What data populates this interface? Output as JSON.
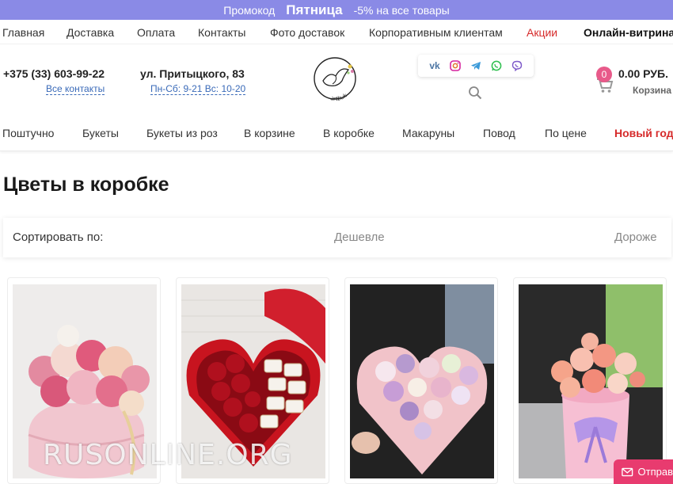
{
  "promo": {
    "prefix": "Промокод",
    "code": "Пятница",
    "discount": "-5% на все товары"
  },
  "topnav": {
    "items": [
      "Главная",
      "Доставка",
      "Оплата",
      "Контакты",
      "Фото доставок",
      "Корпоративным клиентам",
      "Акции",
      "Онлайн-витрина"
    ]
  },
  "header": {
    "phone": "+375 (33) 603-99-22",
    "all_contacts": "Все контакты",
    "address": "ул. Притыцкого, 83",
    "hours": "Пн-Сб: 9-21   Вс: 10-20",
    "logo_text": "artbuket",
    "social_icons": [
      "vk-icon",
      "instagram-icon",
      "telegram-icon",
      "whatsapp-icon",
      "viber-icon"
    ],
    "cart_count": "0",
    "cart_price": "0.00 РУБ.",
    "cart_label": "Корзина"
  },
  "catnav": {
    "items": [
      "Поштучно",
      "Букеты",
      "Букеты из роз",
      "В корзине",
      "В коробке",
      "Макаруны",
      "Повод",
      "По цене",
      "Новый год"
    ]
  },
  "page": {
    "title": "Цветы в коробке"
  },
  "sort": {
    "label": "Сортировать по:",
    "cheaper": "Дешевле",
    "expensive": "Дороже"
  },
  "watermark": "RUSONLINE.ORG",
  "send_button": "Отправ",
  "colors": {
    "promo_bg": "#8a8ae6",
    "accent_red": "#d62b2b",
    "link_blue": "#3a6ab8",
    "badge_pink": "#e85a8a",
    "send_bg": "#e83b6f"
  }
}
